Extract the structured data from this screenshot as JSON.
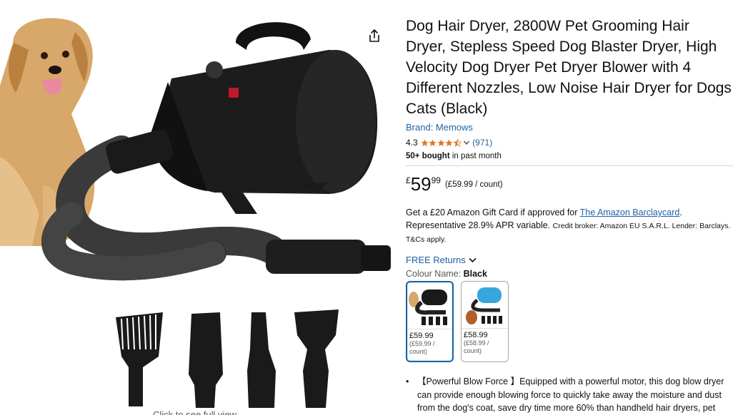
{
  "product": {
    "title": "Dog Hair Dryer, 2800W Pet Grooming Hair Dryer, Stepless Speed Dog Blaster Dryer, High Velocity Dog Dryer Pet Dryer Blower with 4 Different Nozzles, Low Noise Hair Dryer for Dogs Cats (Black)",
    "brand": "Brand: Memows",
    "rating": "4.3",
    "stars_value": 4.3,
    "rating_count": "(971)",
    "bought_bold": "50+ bought",
    "bought_rest": " in past month"
  },
  "price": {
    "currency": "£",
    "whole": "59",
    "fraction": "99",
    "per_unit": "(£59.99 / count)"
  },
  "gift": {
    "prefix": "Get a £20 Amazon Gift Card if approved for ",
    "link": "The Amazon Barclaycard",
    "mid": ". Representative 28.9% APR variable. ",
    "small": "Credit broker: Amazon EU S.A.R.L. Lender: Barclays. T&Cs apply."
  },
  "returns": {
    "label": "FREE Returns"
  },
  "colour": {
    "label": "Colour Name: ",
    "selected": "Black",
    "options": [
      {
        "price": "£59.99",
        "unit1": "(£59.99 /",
        "unit2": "count)",
        "color": "#1a1a1a"
      },
      {
        "price": "£58.99",
        "unit1": "(£58.99 /",
        "unit2": "count)",
        "color": "#35a7dd"
      }
    ]
  },
  "bullets": [
    "【Powerful Blow Force 】Equipped with a powerful motor, this dog blow dryer can provide enough blowing force to quickly take away the moisture and dust from the dog's coat, save dry time more 60% than handheld hair dryers, pet hair drying has never been so easy and fast."
  ],
  "media": {
    "click_full": "Click to see full view"
  }
}
